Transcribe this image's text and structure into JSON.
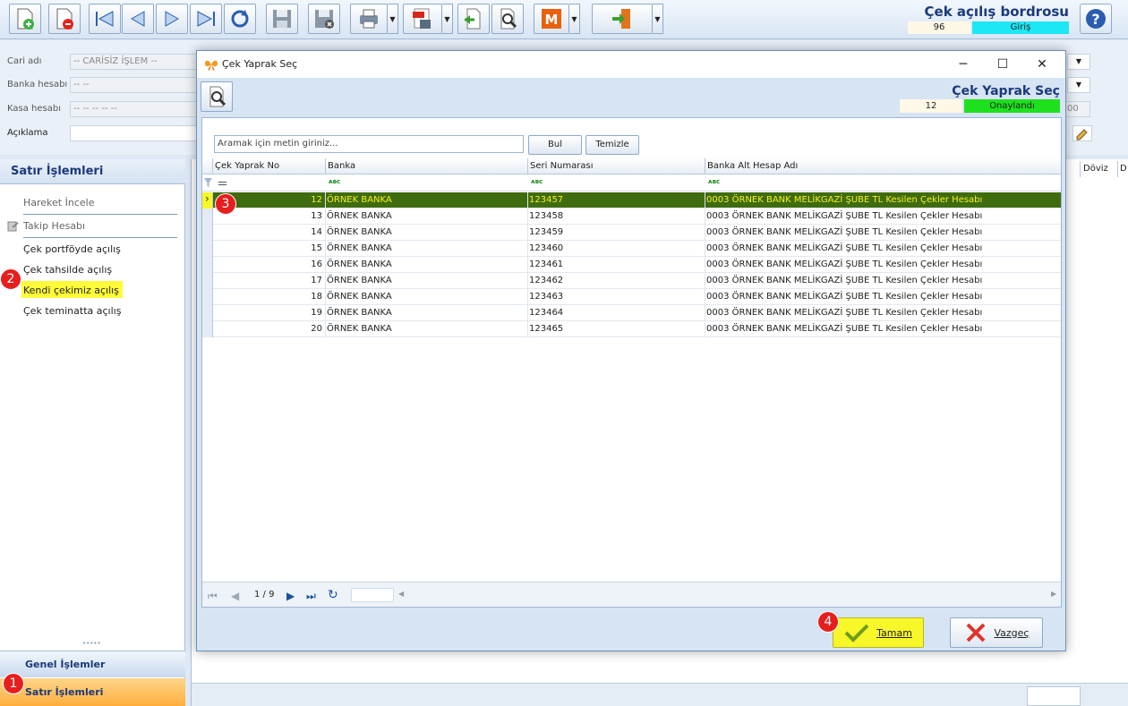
{
  "header": {
    "title": "Çek açılış bordrosu",
    "number": "96",
    "status": "Giriş",
    "status_color": "#1ee7f5"
  },
  "toolbar": {
    "icons": [
      "new-document-icon",
      "delete-document-icon",
      "first-record-icon",
      "previous-record-icon",
      "next-record-icon",
      "last-record-icon",
      "refresh-icon",
      "save-icon",
      "save-close-icon",
      "print-icon",
      "pdf-icon",
      "import-icon",
      "search-tool-icon",
      "m-icon",
      "exit-icon"
    ]
  },
  "form": {
    "cari_label": "Cari adı",
    "cari_value": "-- CARİSİZ İŞLEM --",
    "banka_label": "Banka hesabı",
    "banka_value": "-- --",
    "kasa_label": "Kasa hesabı",
    "kasa_value": "-- -- -- -- --",
    "aciklama_label": "Açıklama",
    "right_fragment": "00"
  },
  "left_panel": {
    "title": "Satır İşlemleri",
    "items": [
      {
        "label": "Hareket İncele",
        "enabled": false
      },
      {
        "label": "Takip Hesabı",
        "enabled": false
      },
      {
        "label": "Çek portföyde açılış",
        "enabled": true
      },
      {
        "label": "Çek tahsilde açılış",
        "enabled": true
      },
      {
        "label": "Kendi çekimiz açılış",
        "enabled": true
      },
      {
        "label": "Çek teminatta açılış",
        "enabled": true
      }
    ],
    "grip": "•••••",
    "nav": [
      {
        "label": "Genel İşlemler"
      },
      {
        "label": "Satır İşlemleri"
      }
    ]
  },
  "right_grid": {
    "columns": [
      "Döviz",
      "D"
    ]
  },
  "badges": [
    "1",
    "2",
    "3",
    "4"
  ],
  "dialog": {
    "window_title": "Çek Yaprak Seç",
    "title": "Çek Yaprak Seç",
    "number": "12",
    "status": "Onaylandı",
    "status_color": "#1de11d",
    "search_placeholder": "Aramak için metin giriniz...",
    "find_label": "Bul",
    "clear_label": "Temizle",
    "columns": [
      "Çek Yaprak No",
      "Banka",
      "Seri Numarası",
      "Banka Alt Hesap Adı"
    ],
    "filter_glyph": "ᴀʙc",
    "rows": [
      {
        "no": "12",
        "banka": "ÖRNEK BANKA",
        "seri": "123457",
        "alt": "0003 ÖRNEK BANK MELİKGAZİ ŞUBE TL Kesilen Çekler Hesabı",
        "selected": true
      },
      {
        "no": "13",
        "banka": "ÖRNEK BANKA",
        "seri": "123458",
        "alt": "0003 ÖRNEK BANK MELİKGAZİ ŞUBE TL Kesilen Çekler Hesabı"
      },
      {
        "no": "14",
        "banka": "ÖRNEK BANKA",
        "seri": "123459",
        "alt": "0003 ÖRNEK BANK MELİKGAZİ ŞUBE TL Kesilen Çekler Hesabı"
      },
      {
        "no": "15",
        "banka": "ÖRNEK BANKA",
        "seri": "123460",
        "alt": "0003 ÖRNEK BANK MELİKGAZİ ŞUBE TL Kesilen Çekler Hesabı"
      },
      {
        "no": "16",
        "banka": "ÖRNEK BANKA",
        "seri": "123461",
        "alt": "0003 ÖRNEK BANK MELİKGAZİ ŞUBE TL Kesilen Çekler Hesabı"
      },
      {
        "no": "17",
        "banka": "ÖRNEK BANKA",
        "seri": "123462",
        "alt": "0003 ÖRNEK BANK MELİKGAZİ ŞUBE TL Kesilen Çekler Hesabı"
      },
      {
        "no": "18",
        "banka": "ÖRNEK BANKA",
        "seri": "123463",
        "alt": "0003 ÖRNEK BANK MELİKGAZİ ŞUBE TL Kesilen Çekler Hesabı"
      },
      {
        "no": "19",
        "banka": "ÖRNEK BANKA",
        "seri": "123464",
        "alt": "0003 ÖRNEK BANK MELİKGAZİ ŞUBE TL Kesilen Çekler Hesabı"
      },
      {
        "no": "20",
        "banka": "ÖRNEK BANKA",
        "seri": "123465",
        "alt": "0003 ÖRNEK BANK MELİKGAZİ ŞUBE TL Kesilen Çekler Hesabı"
      }
    ],
    "pager": "1 / 9",
    "ok_label": "Tamam",
    "cancel_label": "Vazgeç"
  }
}
